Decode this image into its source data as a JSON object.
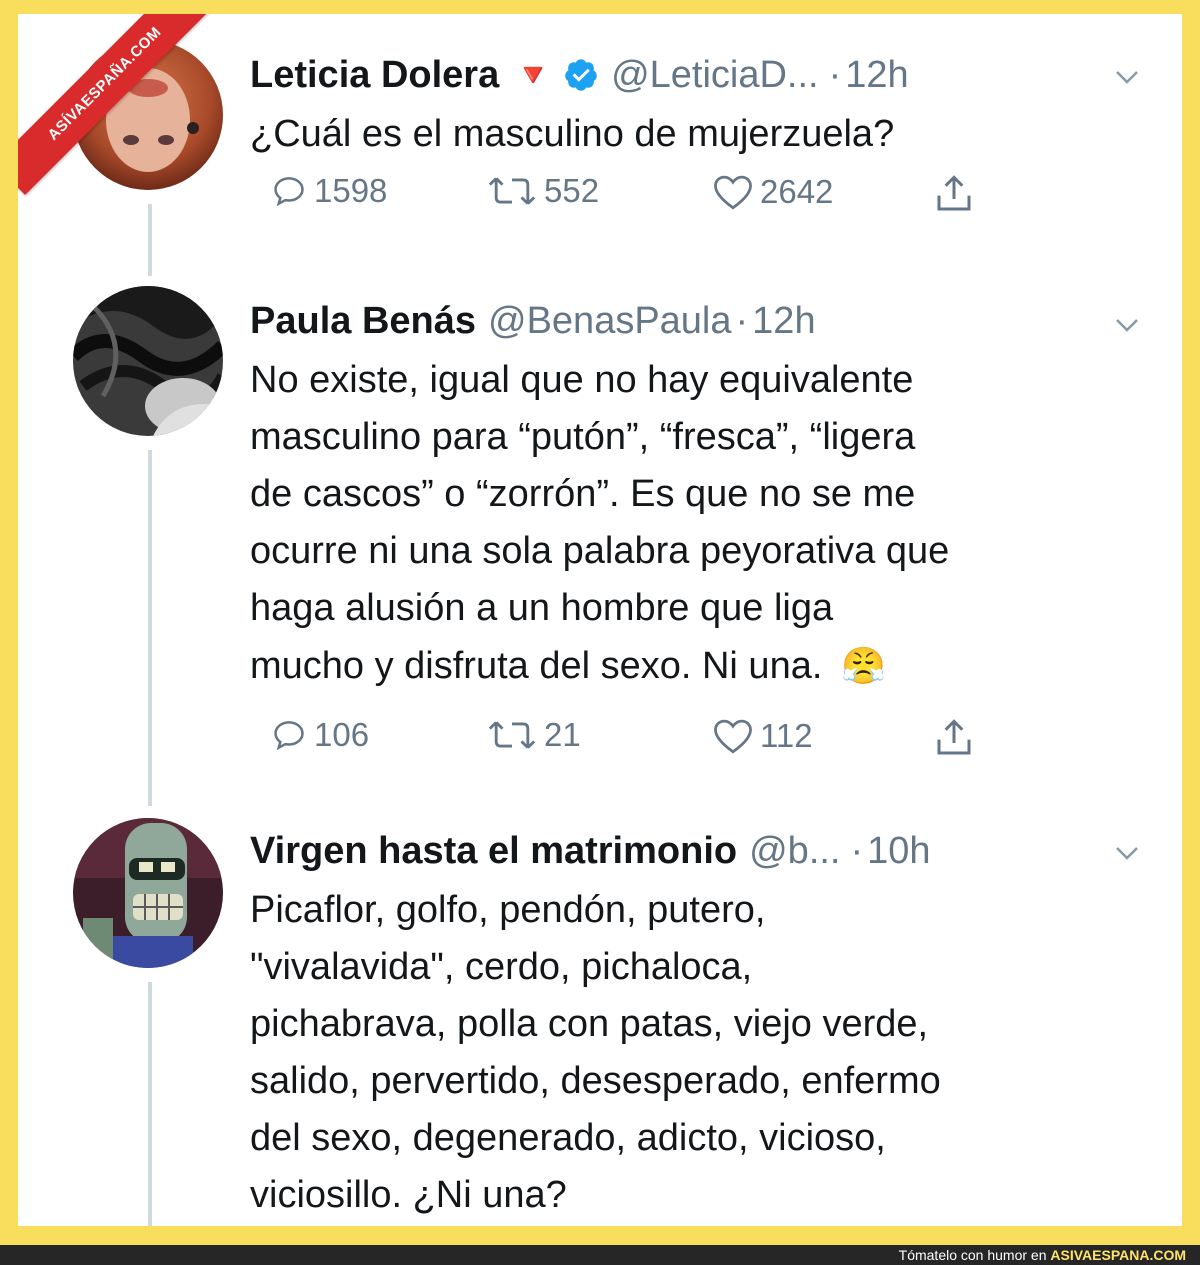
{
  "watermark": {
    "ribbon_text": "ASÍVAESPAÑA.COM",
    "footer_prefix": "Tómatelo con humor en",
    "footer_site": "ASIVAESPANA.COM"
  },
  "colors": {
    "page_background": "#f8de5c",
    "ribbon": "#d92b2b",
    "verified": "#1da1f2",
    "secondary_text": "#657786",
    "thread_line": "#cfd9de"
  },
  "tweets": [
    {
      "name": "Leticia Dolera",
      "emoji": "🔻",
      "verified_icon": "verified-badge-icon",
      "handle": "@LeticiaD...",
      "dot": "·",
      "time": "12h",
      "text": "¿Cuál es el masculino de mujerzuela?",
      "replies": "1598",
      "retweets": "552",
      "likes": "2642"
    },
    {
      "name": "Paula Benás",
      "handle": "@BenasPaula",
      "dot": "·",
      "time": "12h",
      "lines": [
        "No existe, igual que no hay equivalente",
        "masculino para “putón”, “fresca”, “ligera",
        "de cascos” o “zorrón”. Es que no se me",
        "ocurre ni una sola palabra peyorativa que",
        "haga alusión a un hombre que liga",
        "mucho y disfruta del sexo. Ni una."
      ],
      "emoji": "😤",
      "replies": "106",
      "retweets": "21",
      "likes": "112"
    },
    {
      "name": "Virgen hasta el matrimonio",
      "handle": "@b...",
      "dot": "·",
      "time": "10h",
      "lines": [
        "Picaflor, golfo, pendón, putero,",
        "\"vivalavida\", cerdo, pichaloca,",
        "pichabrava, polla con patas, viejo verde,",
        "salido, pervertido, desesperado, enfermo",
        "del sexo, degenerado, adicto, vicioso,",
        "viciosillo. ¿Ni una?"
      ]
    }
  ]
}
